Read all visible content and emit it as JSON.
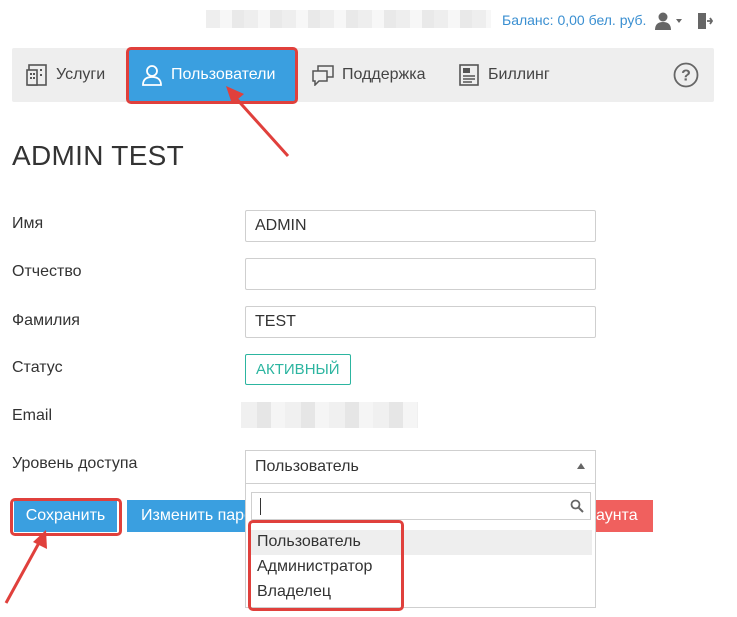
{
  "topbar": {
    "balance": "Баланс: 0,00 бел. руб."
  },
  "nav": {
    "services": "Услуги",
    "users": "Пользователи",
    "support": "Поддержка",
    "billing": "Биллинг"
  },
  "page_title": "ADMIN TEST",
  "form": {
    "first_name_label": "Имя",
    "first_name_value": "ADMIN",
    "patronymic_label": "Отчество",
    "patronymic_value": "",
    "last_name_label": "Фамилия",
    "last_name_value": "TEST",
    "status_label": "Статус",
    "status_value": "АКТИВНЫЙ",
    "email_label": "Email",
    "access_label": "Уровень доступа",
    "access_value": "Пользователь",
    "access_options": [
      "Пользователь",
      "Администратор",
      "Владелец"
    ]
  },
  "buttons": {
    "save": "Сохранить",
    "change_password": "Изменить пароль",
    "delete_account_fragment": "аунта"
  },
  "colors": {
    "accent": "#3a9fe0",
    "status": "#2cb5a0",
    "danger": "#f0605e",
    "highlight": "#e0403c"
  }
}
